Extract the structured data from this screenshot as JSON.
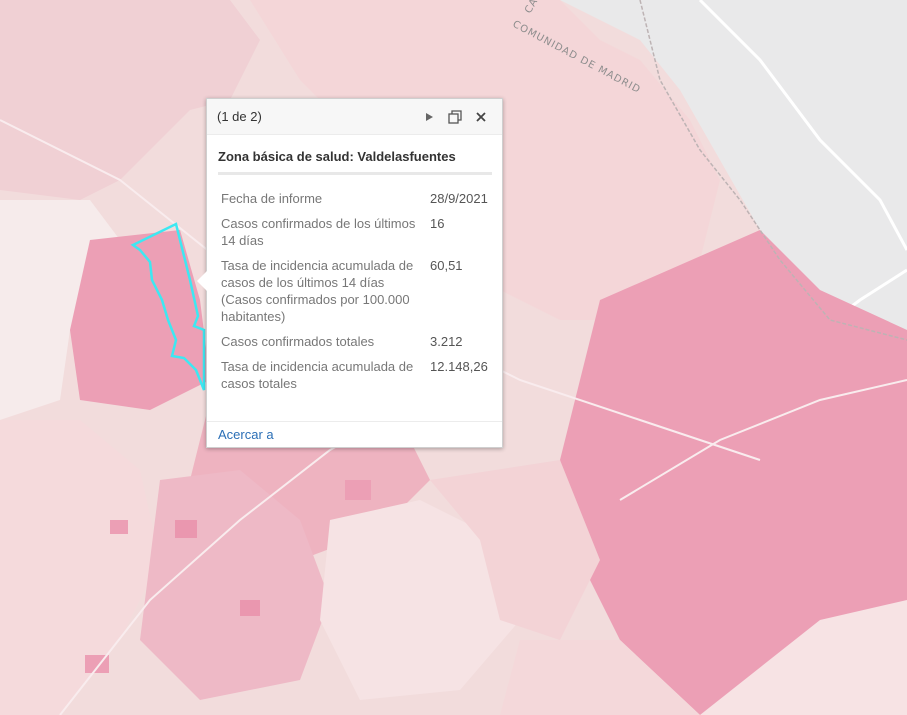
{
  "map": {
    "region_label": "COMUNIDAD DE MADRID",
    "region_label_fragment": "CAS",
    "highlight_color": "#3de8f2",
    "colors": {
      "base": "#f2dcdc",
      "light": "#f6e8e8",
      "medium": "#efc8cf",
      "dark": "#ec9fb5",
      "grey": "#e9e9ea",
      "white_area": "#f5f1f1"
    }
  },
  "popup": {
    "count": "(1 de 2)",
    "title": "Zona básica de salud: Valdelasfuentes",
    "attributes": [
      {
        "key": "Fecha de informe",
        "value": "28/9/2021"
      },
      {
        "key": "Casos confirmados de los últimos 14 días",
        "value": "16"
      },
      {
        "key": "Tasa de incidencia acumulada de casos de los últimos 14 días (Casos confirmados por 100.000 habitantes)",
        "value": "60,51"
      },
      {
        "key": "Casos confirmados totales",
        "value": "3.212"
      },
      {
        "key": "Tasa de incidencia acumulada de casos totales",
        "value": "12.148,26"
      }
    ],
    "zoom_link": "Acercar a",
    "icons": {
      "next": "play-icon",
      "dock": "dock-icon",
      "close": "close-icon"
    }
  }
}
